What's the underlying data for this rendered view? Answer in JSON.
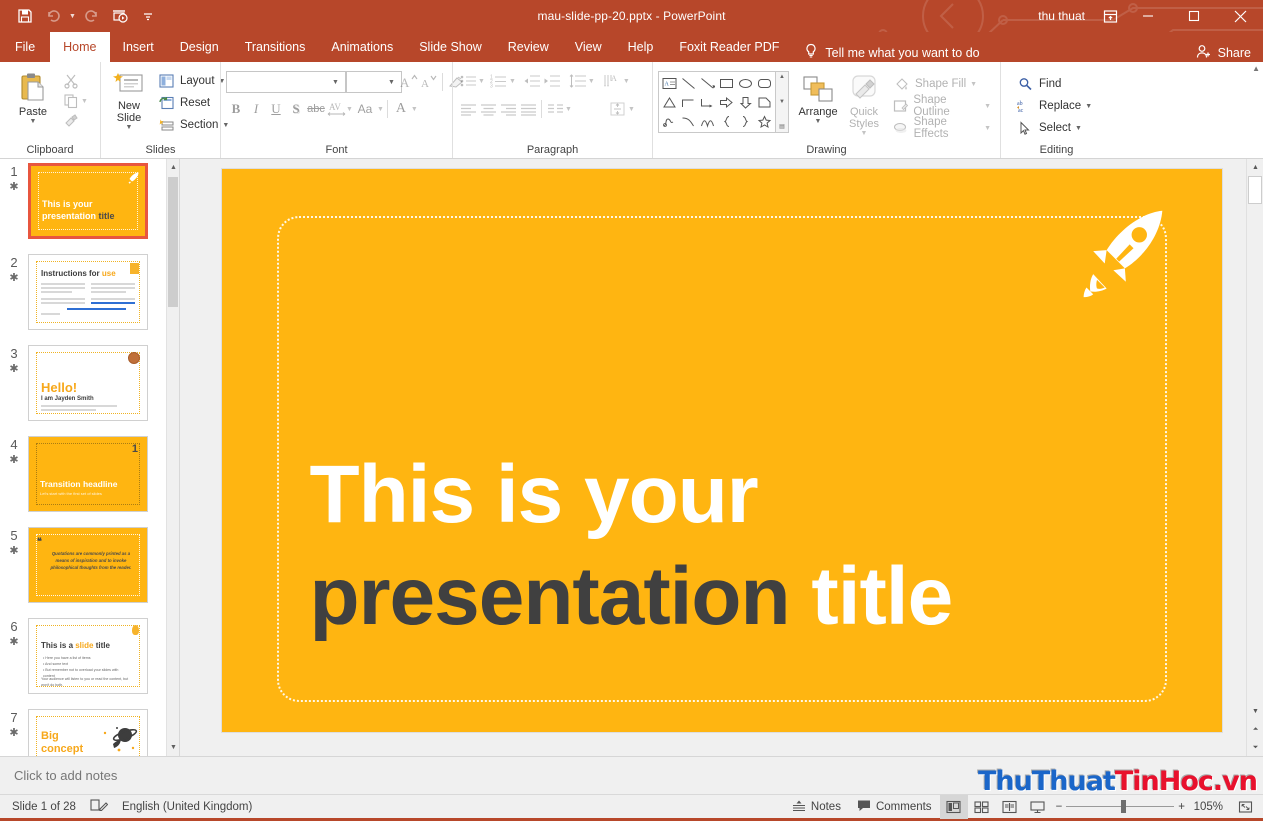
{
  "app": {
    "title": "mau-slide-pp-20.pptx  -  PowerPoint",
    "user": "thu thuat",
    "accent_color": "#b7472a",
    "slide_background": "#FFB511"
  },
  "quick_access": {
    "save": "save-icon",
    "undo": "undo-icon",
    "redo": "redo-icon",
    "start_slideshow": "start-from-beginning-icon",
    "customize": "customize-quick-access-toolbar"
  },
  "window_controls": {
    "ribbon_display": "ribbon-display-options",
    "minimize": "minimize",
    "maximize": "maximize",
    "close": "close"
  },
  "tabs": [
    {
      "label": "File",
      "active": false
    },
    {
      "label": "Home",
      "active": true
    },
    {
      "label": "Insert",
      "active": false
    },
    {
      "label": "Design",
      "active": false
    },
    {
      "label": "Transitions",
      "active": false
    },
    {
      "label": "Animations",
      "active": false
    },
    {
      "label": "Slide Show",
      "active": false
    },
    {
      "label": "Review",
      "active": false
    },
    {
      "label": "View",
      "active": false
    },
    {
      "label": "Help",
      "active": false
    },
    {
      "label": "Foxit Reader PDF",
      "active": false
    }
  ],
  "tell_me": "Tell me what you want to do",
  "share": "Share",
  "ribbon": {
    "clipboard": {
      "label": "Clipboard",
      "paste": "Paste",
      "cut": "cut-icon",
      "copy": "copy-icon",
      "format_painter": "format-painter-icon"
    },
    "slides": {
      "label": "Slides",
      "new_slide": "New Slide",
      "layout": "Layout",
      "reset": "Reset",
      "section": "Section"
    },
    "font": {
      "label": "Font",
      "font_name": "",
      "font_size": "",
      "increase_size": "A",
      "decrease_size": "A",
      "clear_formatting": "clear-formatting-icon",
      "bold": "B",
      "italic": "I",
      "underline": "U",
      "shadow": "S",
      "strikethrough": "abc",
      "character_spacing": "AV",
      "change_case": "Aa",
      "font_color": "A"
    },
    "paragraph": {
      "label": "Paragraph"
    },
    "drawing": {
      "label": "Drawing",
      "arrange": "Arrange",
      "quick_styles": "Quick Styles",
      "shape_fill": "Shape Fill",
      "shape_outline": "Shape Outline",
      "shape_effects": "Shape Effects"
    },
    "editing": {
      "label": "Editing",
      "find": "Find",
      "replace": "Replace",
      "select": "Select"
    }
  },
  "thumbnails": [
    {
      "number": "1",
      "selected": true,
      "bg": "#FFB511",
      "title": "This is your",
      "title2": "presentation title",
      "kind": "title"
    },
    {
      "number": "2",
      "selected": false,
      "bg": "#ffffff",
      "title": "Instructions for",
      "accent_word": "use",
      "kind": "instructions"
    },
    {
      "number": "3",
      "selected": false,
      "bg": "#ffffff",
      "title": "Hello!",
      "subtitle": "I am Jayden Smith",
      "kind": "hello"
    },
    {
      "number": "4",
      "selected": false,
      "bg": "#FFB511",
      "title": "Transition headline",
      "badge": "1",
      "kind": "transition"
    },
    {
      "number": "5",
      "selected": false,
      "bg": "#FFB511",
      "title": "Quotations are commonly printed as a means of inspiration and to invoke philosophical thoughts from the reader.",
      "kind": "quote"
    },
    {
      "number": "6",
      "selected": false,
      "bg": "#ffffff",
      "title": "This is a slide title",
      "accent_word": "slide",
      "kind": "slide-title"
    },
    {
      "number": "7",
      "selected": false,
      "bg": "#ffffff",
      "title": "Big concept",
      "kind": "big-concept"
    }
  ],
  "slide": {
    "line1_white": "This is your",
    "line2_dark": "presentation",
    "line2_white": "title",
    "icon": "rocket-icon",
    "title_white_color": "#ffffff",
    "title_dark_color": "#404040"
  },
  "notes": {
    "placeholder": "Click to add notes"
  },
  "watermark": {
    "blue_part": "ThuThuat",
    "red_part": "TinHoc.vn"
  },
  "status": {
    "slide_counter": "Slide 1 of 28",
    "accessibility": "accessibility-icon",
    "language": "English (United Kingdom)",
    "notes": "Notes",
    "comments": "Comments",
    "views": [
      "normal-view",
      "slide-sorter-view",
      "reading-view",
      "slide-show-view"
    ],
    "zoom_out": "−",
    "zoom_in": "+",
    "zoom_level": "105%",
    "fit_to_window": "fit-slide-to-window-icon"
  }
}
